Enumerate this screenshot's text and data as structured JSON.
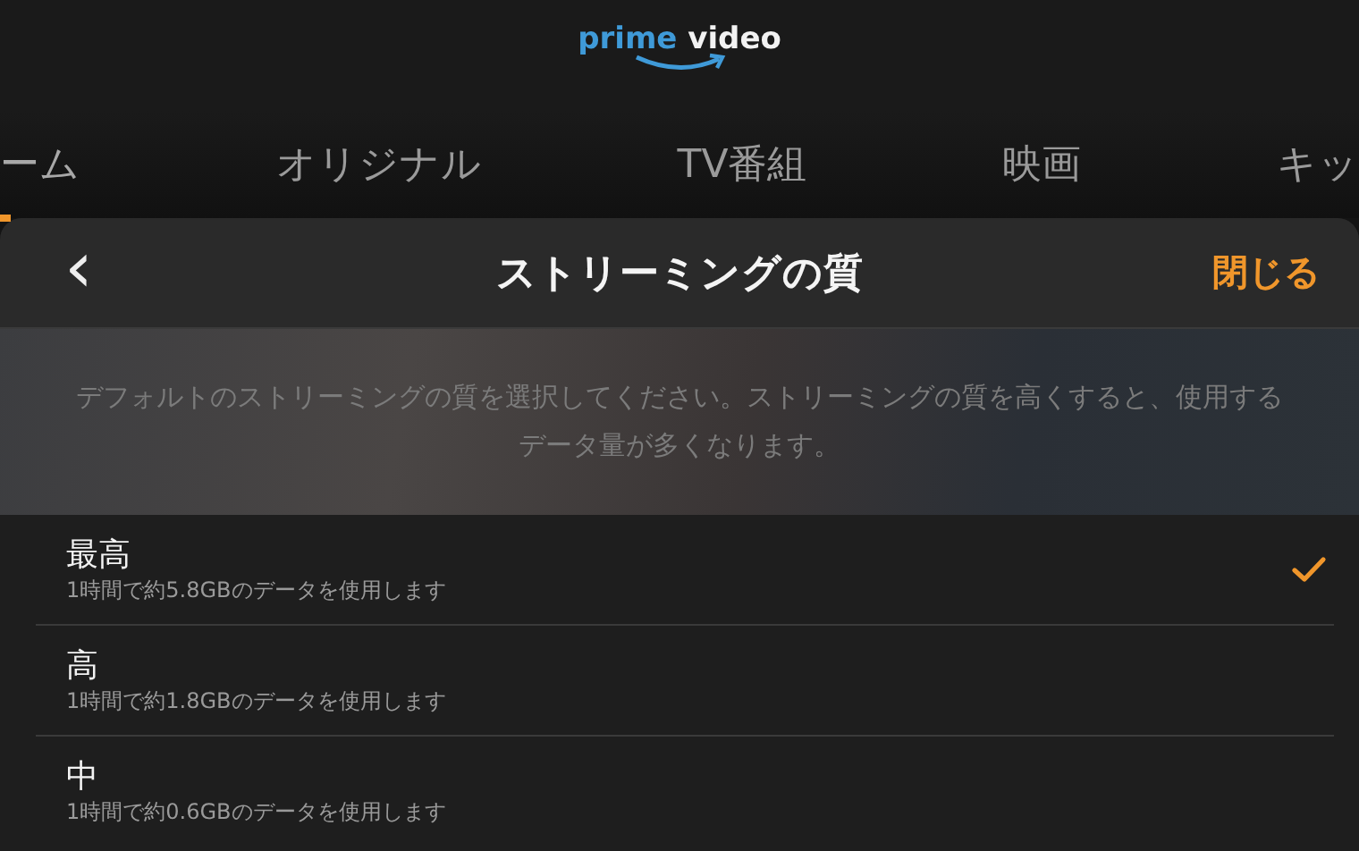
{
  "logo": {
    "word_1": "prime",
    "word_2": "video"
  },
  "nav_tabs": [
    {
      "label": "ーム",
      "selected": true
    },
    {
      "label": "オリジナル",
      "selected": false
    },
    {
      "label": "TV番組",
      "selected": false
    },
    {
      "label": "映画",
      "selected": false
    },
    {
      "label": "キッ",
      "selected": false
    }
  ],
  "sheet": {
    "back_icon": "‹",
    "title": "ストリーミングの質",
    "close": "閉じる",
    "description": "デフォルトのストリーミングの質を選択してください。ストリーミングの質を高くすると、使用するデータ量が多くなります。",
    "options": [
      {
        "label": "最高",
        "detail": "1時間で約5.8GBのデータを使用します",
        "selected": true
      },
      {
        "label": "高",
        "detail": "1時間で約1.8GBのデータを使用します",
        "selected": false
      },
      {
        "label": "中",
        "detail": "1時間で約0.6GBのデータを使用します",
        "selected": false
      }
    ]
  }
}
